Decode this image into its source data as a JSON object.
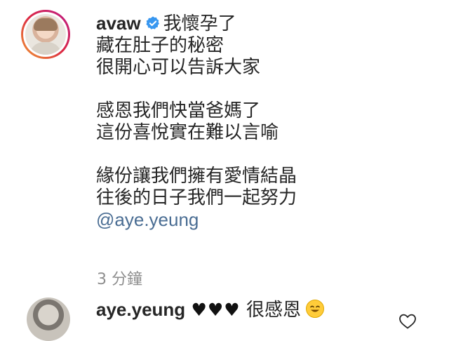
{
  "post": {
    "username": "avaw",
    "caption_lines": [
      "我懷孕了",
      "藏在肚子的秘密",
      "很開心可以告訴大家"
    ],
    "paragraph2": [
      "感恩我們快當爸媽了",
      "這份喜悅實在難以言喻"
    ],
    "paragraph3": [
      "緣份讓我們擁有愛情結晶",
      "往後的日子我們一起努力"
    ],
    "mention": "@aye.yeung",
    "timestamp": "3 分鐘"
  },
  "reply": {
    "username": "aye.yeung",
    "hearts": "♥♥♥",
    "text": "很感恩"
  },
  "icons": {
    "verified": "verified-badge-icon",
    "emoji": "grinning-face-icon",
    "like": "heart-outline-icon"
  },
  "colors": {
    "text": "#262626",
    "mention": "#4a6d93",
    "timestamp": "#8e8e8e",
    "verified": "#3897f0"
  }
}
